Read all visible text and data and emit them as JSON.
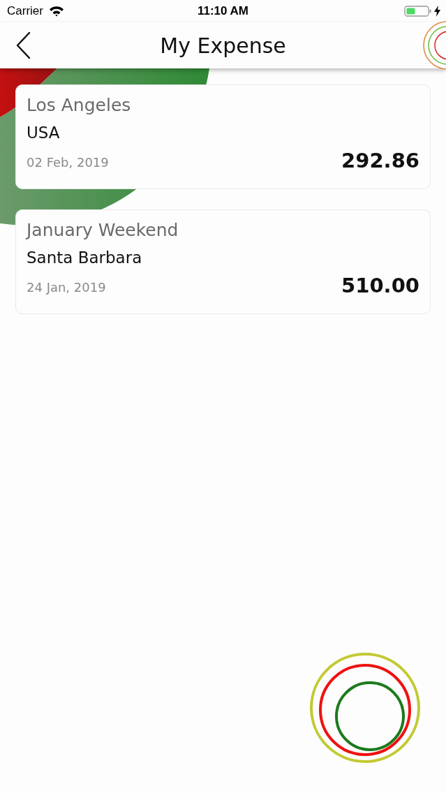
{
  "status_bar": {
    "carrier": "Carrier",
    "time": "11:10 AM"
  },
  "nav": {
    "title": "My Expense"
  },
  "expenses": [
    {
      "title": "Los Angeles",
      "place": "USA",
      "date": "02 Feb, 2019",
      "amount": "292.86"
    },
    {
      "title": "January Weekend",
      "place": "Santa Barbara",
      "date": "24 Jan, 2019",
      "amount": "510.00"
    }
  ]
}
